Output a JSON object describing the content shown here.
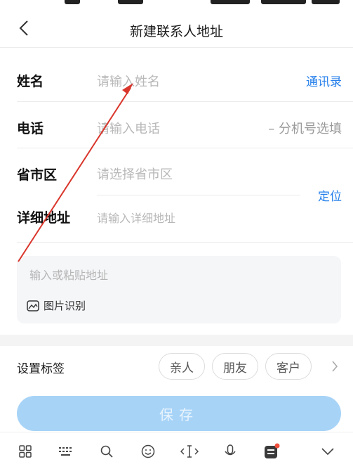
{
  "nav": {
    "title": "新建联系人地址"
  },
  "form": {
    "name": {
      "label": "姓名",
      "placeholder": "请输入姓名",
      "action": "通讯录"
    },
    "phone": {
      "label": "电话",
      "placeholder": "请输入电话",
      "extension": "– 分机号选填"
    },
    "region": {
      "label": "省市区",
      "placeholder": "请选择省市区",
      "action": "定位"
    },
    "detail": {
      "label": "详细地址",
      "placeholder": "请输入详细地址"
    }
  },
  "paste": {
    "placeholder": "输入或粘贴地址",
    "recognize_label": "图片识别"
  },
  "tags": {
    "label": "设置标签",
    "chips": [
      "亲人",
      "朋友",
      "客户"
    ]
  },
  "save_label": "保存",
  "keyboard_toolbar": [
    "grid-icon",
    "keyboard-icon",
    "search-icon",
    "emoji-icon",
    "cursor-icon",
    "microphone-icon",
    "taobao-icon",
    "chevron-down-icon"
  ],
  "colors": {
    "accent": "#2680eb",
    "save_disabled": "#a7d3f7",
    "annotation": "#d9352b"
  }
}
